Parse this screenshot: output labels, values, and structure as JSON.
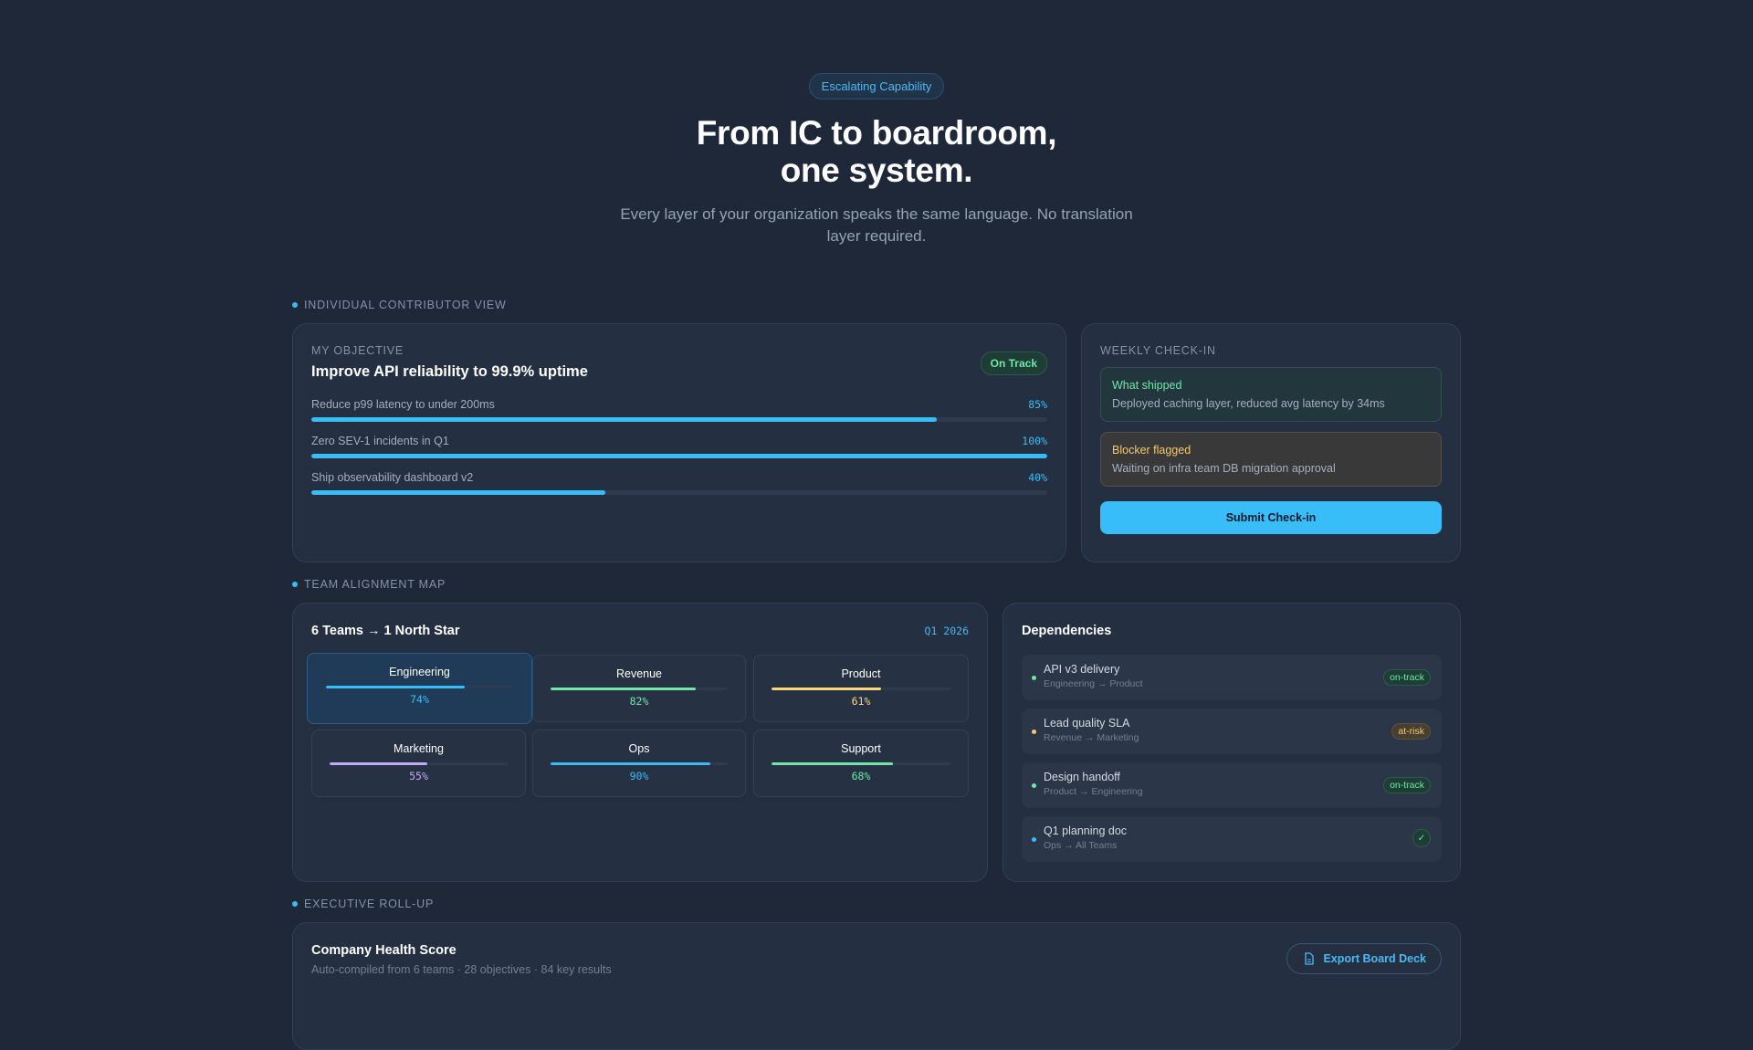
{
  "hero": {
    "pill": "Escalating Capability",
    "title_line1": "From IC to boardroom,",
    "title_line2": "one system.",
    "subtitle": "Every layer of your organization speaks the same language. No translation layer required."
  },
  "sections": {
    "ic": "Individual Contributor View",
    "team": "Team Alignment Map",
    "exec": "Executive Roll-up"
  },
  "objective": {
    "caption": "My Objective",
    "title": "Improve API reliability to 99.9% uptime",
    "status": "On Track",
    "key_results": [
      {
        "label": "Reduce p99 latency to under 200ms",
        "value": "85%",
        "progress": 0.85
      },
      {
        "label": "Zero SEV-1 incidents in Q1",
        "value": "100%",
        "progress": 1.0
      },
      {
        "label": "Ship observability dashboard v2",
        "value": "40%",
        "progress": 0.4
      }
    ]
  },
  "checkin": {
    "caption": "Weekly Check-in",
    "shipped_title": "What shipped",
    "shipped_body": "Deployed caching layer, reduced avg latency by 34ms",
    "blocker_title": "Blocker flagged",
    "blocker_body": "Waiting on infra team DB migration approval",
    "submit_label": "Submit Check-in"
  },
  "teams": {
    "title": "6 Teams → 1 North Star",
    "quarter": "Q1 2026",
    "items": [
      {
        "name": "Engineering",
        "value": "74%",
        "progress": 0.74,
        "color": "#38bdf8"
      },
      {
        "name": "Revenue",
        "value": "82%",
        "progress": 0.82,
        "color": "#6ee7a8"
      },
      {
        "name": "Product",
        "value": "61%",
        "progress": 0.61,
        "color": "#fcd67a"
      },
      {
        "name": "Marketing",
        "value": "55%",
        "progress": 0.55,
        "color": "#c4a8f5"
      },
      {
        "name": "Ops",
        "value": "90%",
        "progress": 0.9,
        "color": "#38bdf8"
      },
      {
        "name": "Support",
        "value": "68%",
        "progress": 0.68,
        "color": "#6ee7a8"
      }
    ]
  },
  "dependencies": {
    "title": "Dependencies",
    "items": [
      {
        "title": "API v3 delivery",
        "path": "Engineering → Product",
        "status": "on-track",
        "dot": "#6ee7a8"
      },
      {
        "title": "Lead quality SLA",
        "path": "Revenue → Marketing",
        "status": "at-risk",
        "dot": "#f4c96a"
      },
      {
        "title": "Design handoff",
        "path": "Product → Engineering",
        "status": "on-track",
        "dot": "#6ee7a8"
      },
      {
        "title": "Q1 planning doc",
        "path": "Ops → All Teams",
        "status": "✓",
        "dot": "#38bdf8"
      }
    ]
  },
  "executive": {
    "title": "Company Health Score",
    "subtitle": "Auto-compiled from 6 teams · 28 objectives · 84 key results",
    "export_label": "Export Board Deck",
    "export_icon": "document-icon"
  }
}
